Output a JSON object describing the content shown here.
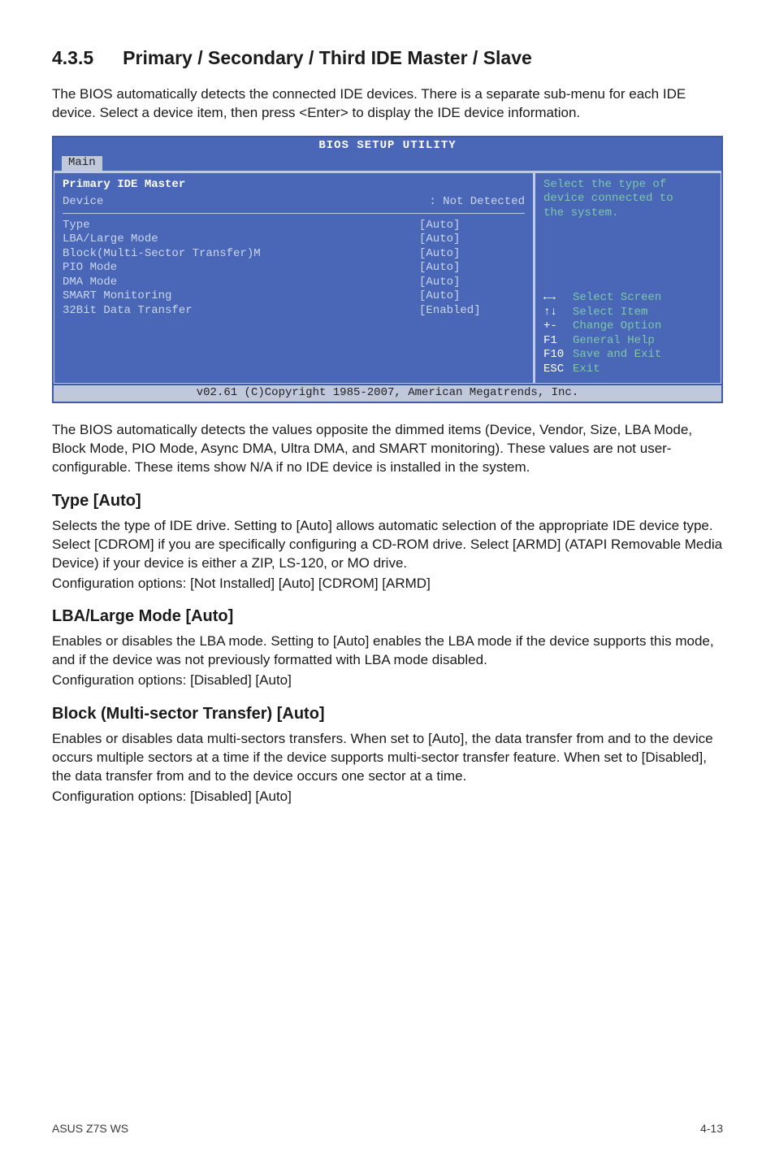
{
  "section": {
    "number": "4.3.5",
    "title": "Primary / Secondary / Third IDE Master / Slave"
  },
  "intro": "The BIOS automatically detects the connected IDE devices. There is a separate sub-menu for each IDE device. Select a device item, then press <Enter> to display the IDE device information.",
  "bios": {
    "title": "BIOS SETUP UTILITY",
    "tab": "Main",
    "panel_title": "Primary IDE Master",
    "device_label": "Device",
    "device_value": ": Not Detected",
    "rows": [
      {
        "label": "Type",
        "value": "[Auto]"
      },
      {
        "label": "LBA/Large Mode",
        "value": "[Auto]"
      },
      {
        "label": "Block(Multi-Sector Transfer)M",
        "value": "[Auto]"
      },
      {
        "label": "PIO Mode",
        "value": "[Auto]"
      },
      {
        "label": "DMA Mode",
        "value": "[Auto]"
      },
      {
        "label": "SMART Monitoring",
        "value": "[Auto]"
      },
      {
        "label": "32Bit Data Transfer",
        "value": "[Enabled]"
      }
    ],
    "help": {
      "desc1": "Select the type of",
      "desc2": "device connected to",
      "desc3": "the system.",
      "lines": [
        {
          "sym": "←→",
          "txt": "Select Screen"
        },
        {
          "sym": "↑↓",
          "txt": "Select Item"
        },
        {
          "sym": "+-",
          "txt": "Change Option"
        },
        {
          "sym": "F1",
          "txt": "General Help"
        },
        {
          "sym": "F10",
          "txt": "Save and Exit"
        },
        {
          "sym": "ESC",
          "txt": "Exit"
        }
      ]
    },
    "footer": "v02.61 (C)Copyright 1985-2007, American Megatrends, Inc."
  },
  "after_bios": "The BIOS automatically detects the values opposite the dimmed items (Device, Vendor, Size, LBA Mode, Block Mode, PIO Mode, Async DMA, Ultra DMA, and SMART monitoring). These values are not user-configurable. These items show N/A if no IDE device is installed in the system.",
  "type": {
    "heading": "Type [Auto]",
    "body": "Selects the type of IDE drive. Setting to [Auto] allows automatic selection of the appropriate IDE device type. Select [CDROM] if you are specifically configuring a CD-ROM drive. Select [ARMD] (ATAPI Removable Media Device) if your device is either a ZIP, LS-120, or MO drive.",
    "opts": "Configuration options: [Not Installed] [Auto] [CDROM] [ARMD]"
  },
  "lba": {
    "heading": "LBA/Large Mode [Auto]",
    "body": "Enables or disables the LBA mode. Setting to [Auto] enables the LBA mode if the device supports this mode, and if the device was not previously formatted with LBA mode disabled.",
    "opts": "Configuration options: [Disabled] [Auto]"
  },
  "block": {
    "heading": "Block (Multi-sector Transfer) [Auto]",
    "body": "Enables or disables data multi-sectors transfers. When set to [Auto], the data transfer from and to the device occurs multiple sectors at a time if the device supports multi-sector transfer feature. When set to [Disabled], the data transfer from and to the device occurs one sector at a time.",
    "opts": "Configuration options: [Disabled] [Auto]"
  },
  "footer": {
    "left": "ASUS Z7S WS",
    "right": "4-13"
  }
}
